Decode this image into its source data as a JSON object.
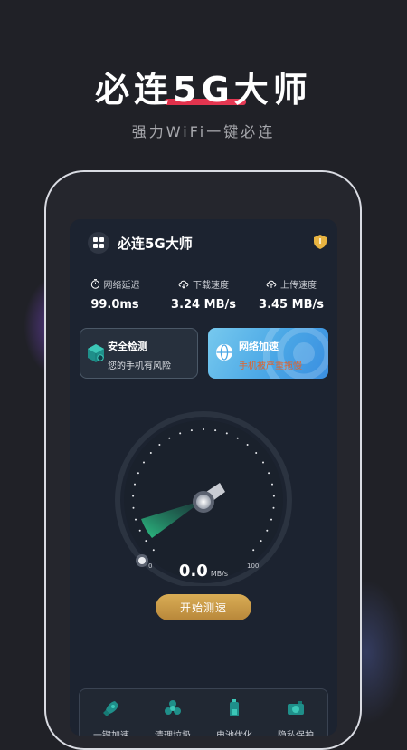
{
  "hero": {
    "title": "必连5G大师",
    "subtitle": "强力WiFi一键必连"
  },
  "app": {
    "title": "必连5G大师"
  },
  "stats": [
    {
      "icon": "timer-icon",
      "label": "网络延迟",
      "value": "99.0ms"
    },
    {
      "icon": "cloud-download-icon",
      "label": "下载速度",
      "value": "3.24 MB/s"
    },
    {
      "icon": "cloud-upload-icon",
      "label": "上传速度",
      "value": "3.45 MB/s"
    }
  ],
  "cards": {
    "security": {
      "title": "安全检测",
      "desc": "您的手机有风险"
    },
    "boost": {
      "title": "网络加速",
      "desc": "手机被严重拖慢"
    }
  },
  "gauge": {
    "min_label": "0",
    "max_label": "100",
    "speed_value": "0.0",
    "speed_unit": "MB/s"
  },
  "actions": {
    "start_label": "开始测速"
  },
  "tools": [
    {
      "icon": "rocket-icon",
      "label": "一键加速"
    },
    {
      "icon": "fan-icon",
      "label": "清理垃圾"
    },
    {
      "icon": "battery-icon",
      "label": "电池优化"
    },
    {
      "icon": "camera-icon",
      "label": "隐私保护"
    }
  ],
  "colors": {
    "accent_gold": "#c89a45",
    "accent_red": "#e0304a",
    "gauge_green": "#2fd38f",
    "boost_blue": "#4aa7e6",
    "warning_orange": "#e2632b"
  }
}
